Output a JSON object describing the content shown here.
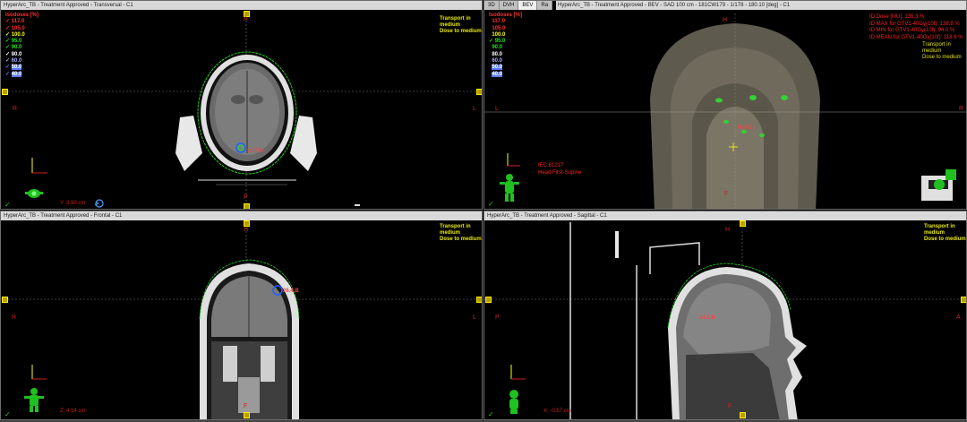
{
  "panes": {
    "transversal": {
      "title": "HyperArc_TB - Treatment Approved - Transversal - C1",
      "orient": {
        "top": "A",
        "bottom": "P",
        "left": "R",
        "right": "L"
      },
      "coord": "Y: 3.90 cm",
      "label": "31.7 B"
    },
    "bev": {
      "tabs": [
        "3D",
        "DVH",
        "BEV",
        "Ra"
      ],
      "title": "HyperArc_TB - Treatment Approved - BEV - SAD 100 cm - 181CW179 - 1/178 - 180.10 [deg] - C1",
      "orient": {
        "top": "H",
        "bottom": "F",
        "left": "L",
        "right": "R"
      },
      "field": "IEC 61217",
      "position": "Head First-Supine",
      "label": "40.4 B",
      "stats": [
        "ID Dose [MU]: 135.3 %",
        "ID MAX for GTV1-40Gy(10f): 138.8 %",
        "ID MIN for GTV1-40Gy(10f): 94.0 %",
        "ID MEAN for GTV1-40Gy(10f): 118.6 %"
      ]
    },
    "frontal": {
      "title": "HyperArc_TB - Treatment Approved - Frontal - C1",
      "orient": {
        "top": "H",
        "bottom": "F",
        "left": "R",
        "right": "L"
      },
      "coord": "Z: 4.14 cm",
      "label": "26.4 B"
    },
    "sagittal": {
      "title": "HyperArc_TB - Treatment Approved - Sagittal - C1",
      "orient": {
        "top": "H",
        "bottom": "F",
        "left": "P",
        "right": "A"
      },
      "coord": "X: -0.57 cm",
      "label": "24.1 B"
    }
  },
  "isodose": {
    "header": "Isodoses [%]",
    "levels": [
      {
        "value": "117.0",
        "color": "#ff3030"
      },
      {
        "value": "105.0",
        "color": "#ff3030"
      },
      {
        "value": "100.0",
        "color": "#ffff00"
      },
      {
        "value": "95.0",
        "color": "#20e020"
      },
      {
        "value": "90.0",
        "color": "#20e020"
      },
      {
        "value": "80.0",
        "color": "#ffffff"
      },
      {
        "value": "60.0",
        "color": "#aaaaff"
      },
      {
        "value": "50.0",
        "color": "#5b7bff"
      },
      {
        "value": "40.0",
        "color": "#5b7bff"
      }
    ]
  },
  "transport_note": [
    "Transport in",
    "medium",
    "Dose to medium"
  ],
  "icons": [
    "patient-orientation-icon",
    "rotate-icon",
    "gantry-icon",
    "checkmark-icon"
  ]
}
